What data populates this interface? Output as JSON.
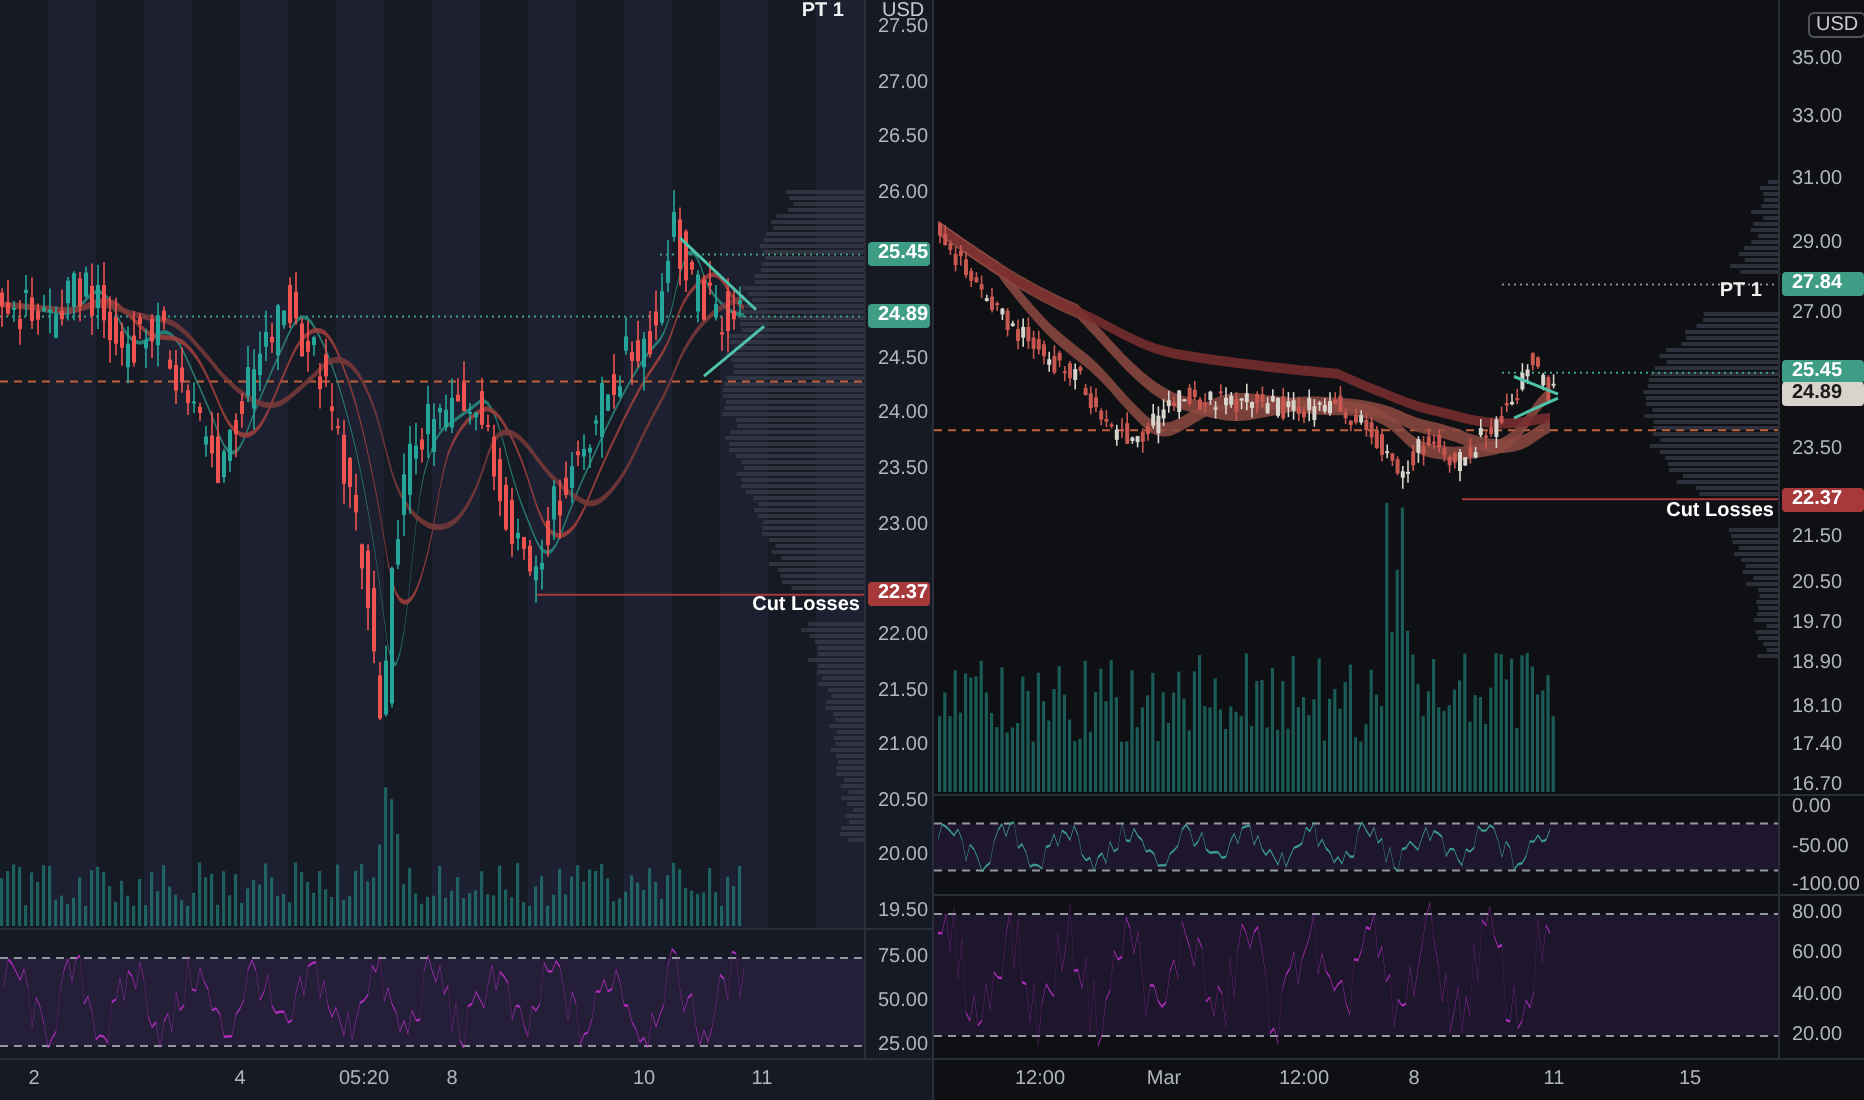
{
  "panels": [
    {
      "unit": "USD",
      "panes": [
        {
          "ticks": [
            "27.50",
            "27.00",
            "26.50",
            "26.00",
            "24.50",
            "24.00",
            "23.50",
            "23.00",
            "22.00",
            "21.50",
            "21.00",
            "20.50",
            "20.00",
            "19.50"
          ],
          "badges": [
            {
              "text": "25.45",
              "color": "#3f9d86"
            },
            {
              "text": "24.89",
              "color": "#3f9d86"
            },
            {
              "text": "22.37",
              "color": "#a8393b"
            }
          ]
        },
        {
          "ticks": [
            "75.00",
            "50.00",
            "25.00"
          ]
        }
      ],
      "annotations": [
        {
          "text": "PT 1",
          "kind": "target"
        },
        {
          "text": "Cut Losses",
          "kind": "stop"
        }
      ],
      "time_labels": [
        "2",
        "4",
        "05:20",
        "8",
        "10",
        "11"
      ]
    },
    {
      "unit": "USD",
      "panes": [
        {
          "ticks": [
            "35.00",
            "33.00",
            "31.00",
            "29.00",
            "27.00",
            "23.50",
            "21.50",
            "20.50",
            "19.70",
            "18.90",
            "18.10",
            "17.40",
            "16.70"
          ],
          "badges": [
            {
              "text": "27.84",
              "color": "#3f9d86"
            },
            {
              "text": "25.45",
              "color": "#3f9d86"
            },
            {
              "text": "24.89",
              "color": "#d8d4cc"
            },
            {
              "text": "22.37",
              "color": "#a8393b"
            }
          ]
        },
        {
          "ticks": [
            "0.00",
            "-50.00",
            "-100.00"
          ]
        },
        {
          "ticks": [
            "80.00",
            "60.00",
            "40.00",
            "20.00"
          ]
        }
      ],
      "annotations": [
        {
          "text": "PT 1",
          "kind": "target"
        },
        {
          "text": "Cut Losses",
          "kind": "stop"
        }
      ],
      "time_labels": [
        "12:00",
        "Mar",
        "12:00",
        "8",
        "11",
        "15"
      ]
    }
  ]
}
